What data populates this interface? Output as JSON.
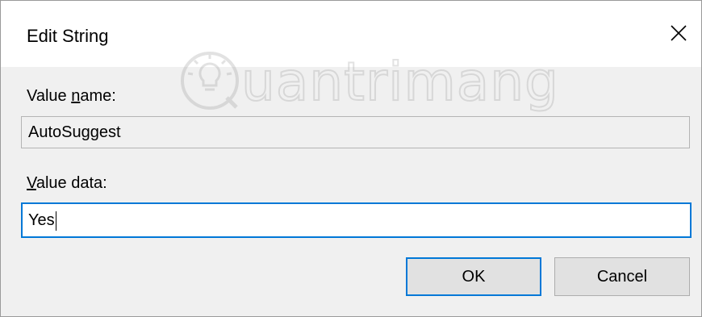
{
  "window": {
    "title": "Edit String",
    "close_glyph": "✕"
  },
  "watermark": {
    "text": "uantrimang",
    "icon": "lightbulb-icon"
  },
  "value_name": {
    "label_prefix": "Value ",
    "label_underlined": "n",
    "label_suffix": "ame:",
    "value": "AutoSuggest"
  },
  "value_data": {
    "label_underlined": "V",
    "label_suffix": "alue data:",
    "value": "Yes"
  },
  "buttons": {
    "ok_label": "OK",
    "cancel_label": "Cancel"
  },
  "colors": {
    "accent": "#0078d7",
    "dialog_bg": "#f0f0f0",
    "button_bg": "#e1e1e1"
  }
}
